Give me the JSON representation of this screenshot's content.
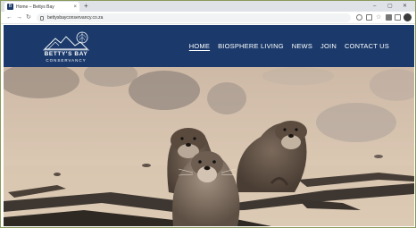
{
  "browser": {
    "tab_title": "Home – Bettys Bay",
    "tab_favicon_letter": "B",
    "url": "bettysbayconservancy.co.za"
  },
  "site": {
    "logo": {
      "line1": "BETTY'S BAY",
      "line2": "CONSERVANCY"
    },
    "nav": [
      {
        "label": "HOME",
        "active": true
      },
      {
        "label": "BIOSPHERE LIVING",
        "active": false
      },
      {
        "label": "NEWS",
        "active": false
      },
      {
        "label": "JOIN",
        "active": false
      },
      {
        "label": "CONTACT US",
        "active": false
      }
    ]
  },
  "colors": {
    "header_bg": "#1b3a6b",
    "nav_text": "#ffffff"
  },
  "hero": {
    "image": "three otters on a sandy beach with rocks and driftwood"
  }
}
